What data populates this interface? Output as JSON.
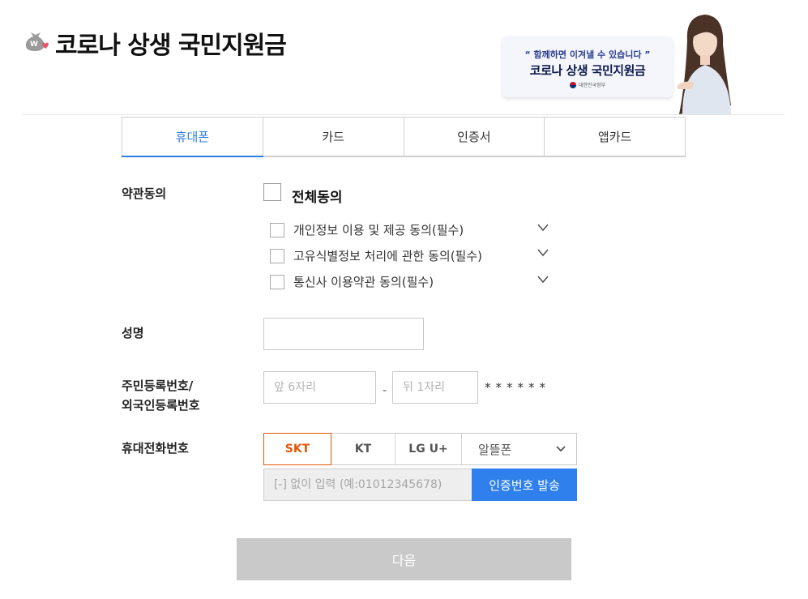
{
  "header": {
    "title": "코로나 상생 국민지원금",
    "logo_icon": "money-bag-heart-icon"
  },
  "banner": {
    "slogan": "“ 함께하면 이겨낼 수 있습니다 ”",
    "title": "코로나 상생 국민지원금",
    "gov": "대한민국정부"
  },
  "tabs": [
    {
      "label": "휴대폰",
      "active": true
    },
    {
      "label": "카드",
      "active": false
    },
    {
      "label": "인증서",
      "active": false
    },
    {
      "label": "앱카드",
      "active": false
    }
  ],
  "terms": {
    "label": "약관동의",
    "agree_all": "전체동의",
    "items": [
      {
        "label": "개인정보 이용 및 제공 동의(필수)"
      },
      {
        "label": "고유식별정보 처리에 관한 동의(필수)"
      },
      {
        "label": "통신사 이용약관 동의(필수)"
      }
    ]
  },
  "name_field": {
    "label": "성명",
    "value": ""
  },
  "resident": {
    "label_line1": "주민등록번호/",
    "label_line2": "외국인등록번호",
    "front_placeholder": "앞 6자리",
    "back_placeholder": "뒤 1자리",
    "dash": "-",
    "mask": "******"
  },
  "phone": {
    "label": "휴대전화번호",
    "carriers": [
      "SKT",
      "KT",
      "LG U+"
    ],
    "selected_carrier": "SKT",
    "mvno_select": "알뜰폰",
    "number_placeholder": "[-] 없이 입력 (예:01012345678)",
    "send_button": "인증번호 발송"
  },
  "next_button": "다음",
  "colors": {
    "accent_blue": "#2f7de1",
    "carrier_selected": "#e2570b",
    "disabled_button": "#c9c9c9"
  }
}
